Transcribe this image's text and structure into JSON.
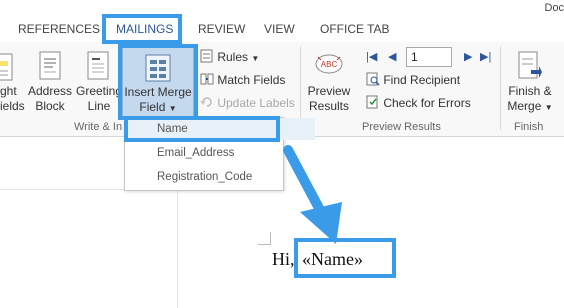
{
  "tabs": [
    "REFERENCES",
    "MAILINGS",
    "REVIEW",
    "VIEW",
    "OFFICE TAB"
  ],
  "window_title_partial": "Doc",
  "ribbon": {
    "highlight_fields": {
      "line1": "ght",
      "line2": "ields"
    },
    "address_block": {
      "line1": "Address",
      "line2": "Block"
    },
    "greeting_line": {
      "line1": "Greeting",
      "line2": "Line"
    },
    "insert_merge_field": {
      "line1": "Insert Merge",
      "line2": "Field"
    },
    "rules_label": "Rules",
    "match_fields_label": "Match Fields",
    "update_labels_label": "Update Labels",
    "preview_results": {
      "line1": "Preview",
      "line2": "Results"
    },
    "record_number": "1",
    "find_recipient_label": "Find Recipient",
    "check_errors_label": "Check for Errors",
    "finish_merge": {
      "line1": "Finish &",
      "line2": "Merge"
    },
    "groups": {
      "write_insert": "Write & In",
      "preview_results": "Preview Results",
      "finish": "Finish"
    }
  },
  "dropdown_items": [
    "Name",
    "Email_Address",
    "Registration_Code"
  ],
  "document": {
    "greeting": "Hi,",
    "merge_field": "«Name»"
  },
  "colors": {
    "accent": "#2b579a",
    "highlight": "#3a9be8",
    "pressed_button": "#c5d9ee"
  }
}
